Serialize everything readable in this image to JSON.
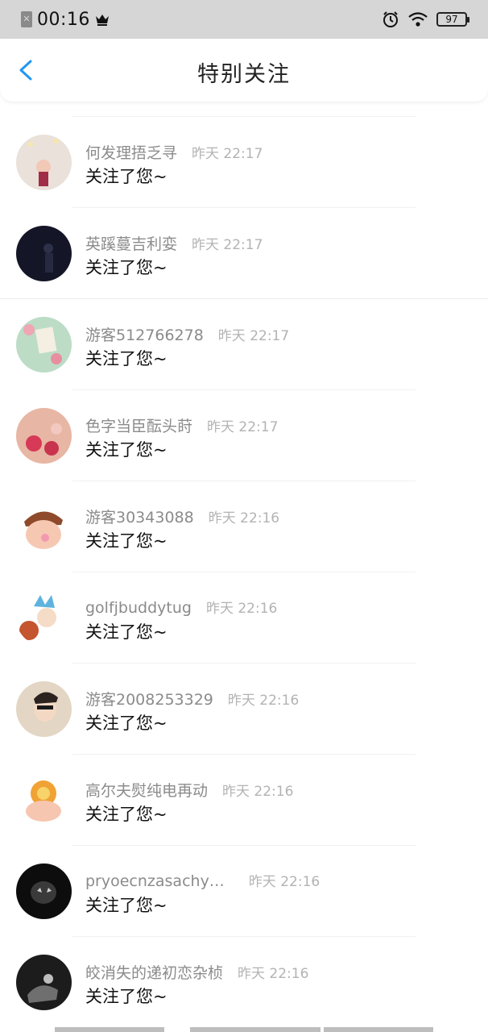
{
  "status_bar": {
    "time": "00:16",
    "battery": "97"
  },
  "nav": {
    "title": "特别关注"
  },
  "items": [
    {
      "name": "何发理捂乏寻",
      "time": "昨天 22:17",
      "message": "关注了您~",
      "avatar": "#e8c0b0"
    },
    {
      "name": "英蹊蔓吉利娈",
      "time": "昨天 22:17",
      "message": "关注了您~",
      "avatar": "#1a1c2e"
    },
    {
      "name": "游客512766278",
      "time": "昨天 22:17",
      "message": "关注了您~",
      "avatar": "#b9d8c4"
    },
    {
      "name": "色字当臣酝头莳",
      "time": "昨天 22:17",
      "message": "关注了您~",
      "avatar": "#c8455a"
    },
    {
      "name": "游客30343088",
      "time": "昨天 22:16",
      "message": "关注了您~",
      "avatar": "#f2d0b0"
    },
    {
      "name": "golfjbuddytug",
      "time": "昨天 22:16",
      "message": "关注了您~",
      "avatar": "#6ab0d8"
    },
    {
      "name": "游客2008253329",
      "time": "昨天 22:16",
      "message": "关注了您~",
      "avatar": "#d8c0a0"
    },
    {
      "name": "高尔夫熨纯电再动",
      "time": "昨天 22:16",
      "message": "关注了您~",
      "avatar": "#f0a040"
    },
    {
      "name": "pryoecnzasachy…",
      "time": "昨天 22:16",
      "message": "关注了您~",
      "avatar": "#111111"
    },
    {
      "name": "皎消失的递初恋杂桢",
      "time": "昨天 22:16",
      "message": "关注了您~",
      "avatar": "#2a2a2a"
    }
  ]
}
